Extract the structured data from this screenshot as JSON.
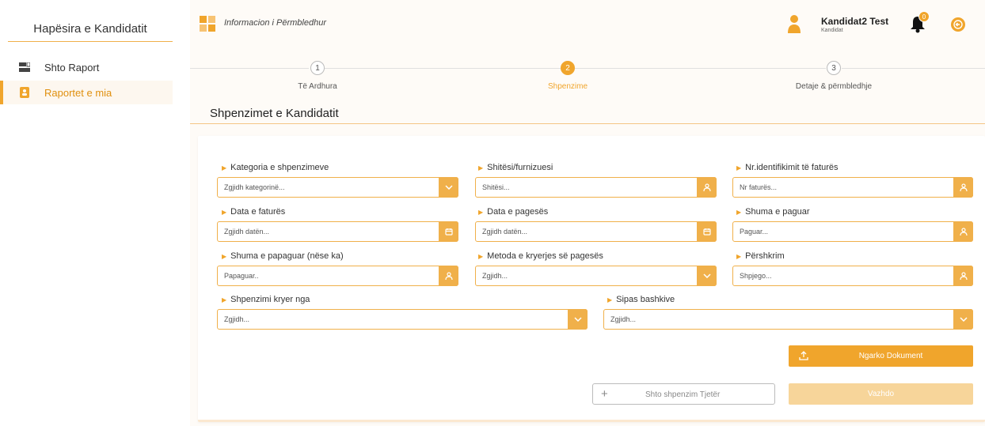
{
  "sidebar": {
    "title": "Hapësira e Kandidatit",
    "items": [
      {
        "label": "Shto Raport",
        "icon": "report-add-icon",
        "active": false
      },
      {
        "label": "Raportet e mia",
        "icon": "contacts-book-icon",
        "active": true
      }
    ]
  },
  "header": {
    "breadcrumb": "Informacion i Përmbledhur",
    "user_name": "Kandidat2 Test",
    "user_role": "Kandidat",
    "notification_count": "0"
  },
  "stepper": {
    "steps": [
      {
        "number": "1",
        "label": "Të Ardhura",
        "active": false
      },
      {
        "number": "2",
        "label": "Shpenzime",
        "active": true
      },
      {
        "number": "3",
        "label": "Detaje & përmbledhje",
        "active": false
      }
    ]
  },
  "section_title": "Shpenzimet e Kandidatit",
  "form": {
    "fields": [
      {
        "label": "Kategoria e shpenzimeve",
        "placeholder": "Zgjidh kategorinë...",
        "icon": "chevron-down-icon"
      },
      {
        "label": "Shitësi/furnizuesi",
        "placeholder": "Shitësi...",
        "icon": "user-icon"
      },
      {
        "label": "Nr.identifikimit të faturës",
        "placeholder": "Nr faturës...",
        "icon": "user-icon"
      },
      {
        "label": "Data e faturës",
        "placeholder": "Zgjidh datën...",
        "icon": "calendar-icon"
      },
      {
        "label": "Data e pagesës",
        "placeholder": "Zgjidh datën...",
        "icon": "calendar-icon"
      },
      {
        "label": "Shuma e paguar",
        "placeholder": "Paguar...",
        "icon": "user-icon"
      },
      {
        "label": "Shuma e papaguar (nëse ka)",
        "placeholder": "Papaguar..",
        "icon": "user-icon"
      },
      {
        "label": "Metoda e kryerjes së pagesës",
        "placeholder": "Zgjidh...",
        "icon": "chevron-down-icon"
      },
      {
        "label": "Përshkrim",
        "placeholder": "Shpjego...",
        "icon": "user-icon"
      },
      {
        "label": "Shpenzimi kryer nga",
        "placeholder": "Zgjidh...",
        "icon": "chevron-down-icon"
      },
      {
        "label": "Sipas bashkive",
        "placeholder": "Zgjidh...",
        "icon": "chevron-down-icon"
      }
    ]
  },
  "buttons": {
    "upload": "Ngarko Dokument",
    "add_expense": "Shto shpenzim Tjetër",
    "continue": "Vazhdo"
  },
  "colors": {
    "accent": "#f0a52c",
    "accent_light": "#f7d59a",
    "field_border": "#f0b04a"
  }
}
